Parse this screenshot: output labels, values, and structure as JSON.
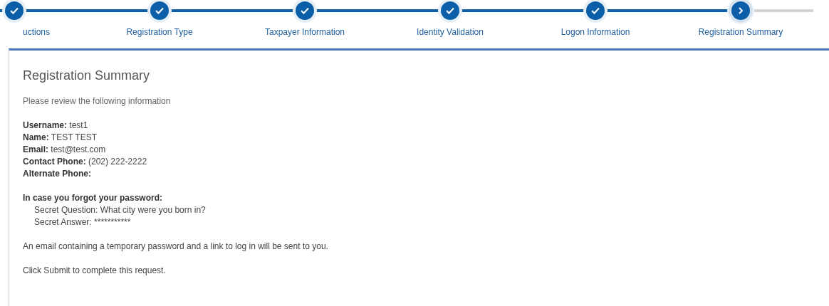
{
  "steps": [
    {
      "label": "uctions",
      "completed": true,
      "selected": false
    },
    {
      "label": "Registration Type",
      "completed": true,
      "selected": false
    },
    {
      "label": "Taxpayer Information",
      "completed": true,
      "selected": false
    },
    {
      "label": "Identity Validation",
      "completed": true,
      "selected": false
    },
    {
      "label": "Logon Information",
      "completed": true,
      "selected": false
    },
    {
      "label": "Registration Summary",
      "completed": false,
      "selected": true
    }
  ],
  "panel": {
    "title": "Registration Summary",
    "intro": "Please review the following information",
    "fields": [
      {
        "label": "Username:",
        "value": "test1"
      },
      {
        "label": "Name:",
        "value": "TEST TEST"
      },
      {
        "label": "Email:",
        "value": "test@test.com"
      },
      {
        "label": "Contact Phone:",
        "value": "(202) 222-2222"
      },
      {
        "label": "Alternate Phone:"
      }
    ],
    "recovery_heading": "In case you forgot your password:",
    "recovery": [
      "Secret Question: What city were you born in?",
      "Secret Answer: ***********"
    ],
    "notes": [
      "An email containing a temporary password and a link to log in will be sent to you.",
      "Click Submit to complete this request."
    ]
  }
}
